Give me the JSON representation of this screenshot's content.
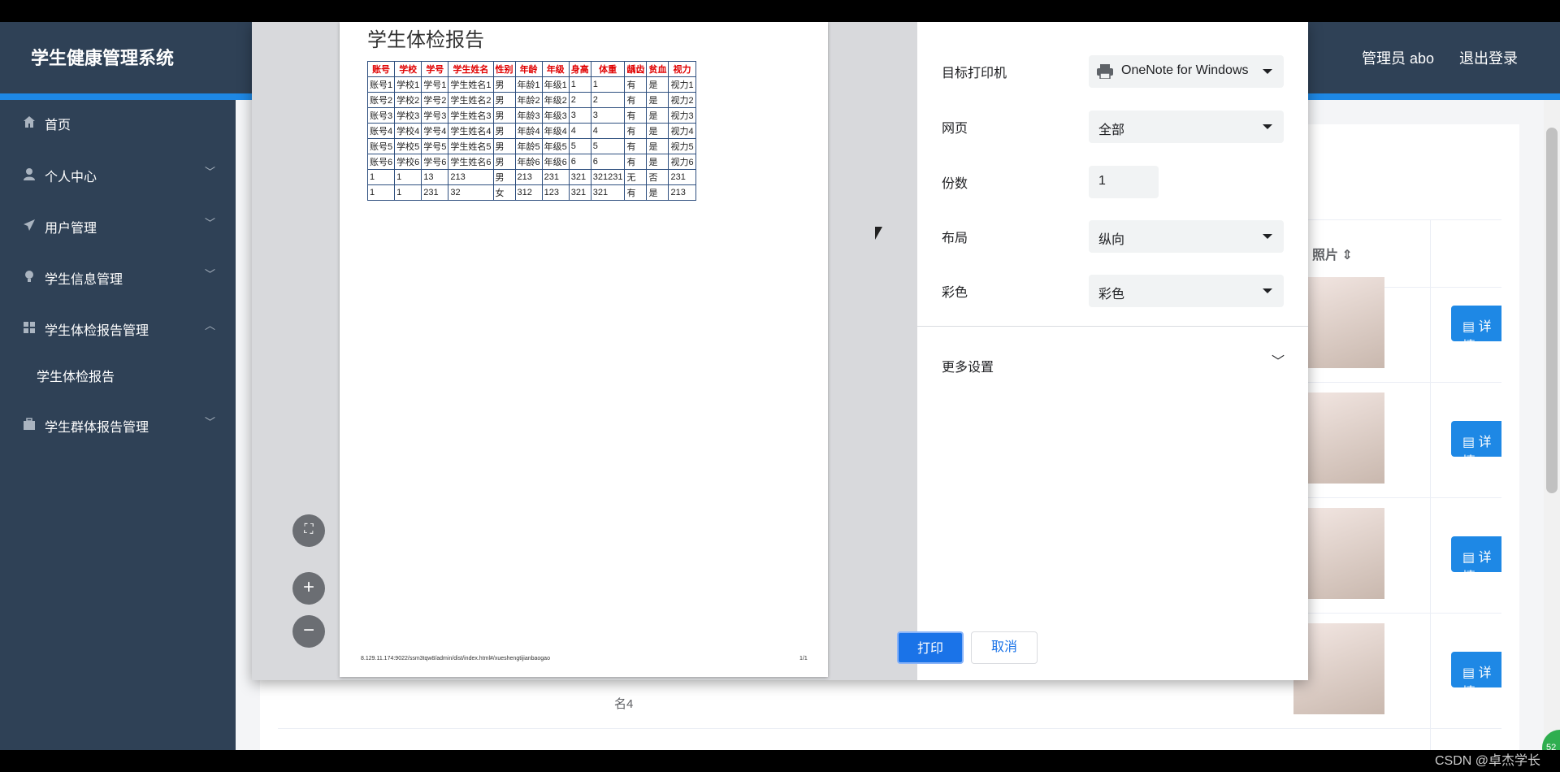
{
  "app": {
    "title": "学生健康管理系统",
    "user": "管理员 abo",
    "logout": "退出登录"
  },
  "sidebar": {
    "items": [
      {
        "label": "首页",
        "icon": "home-icon"
      },
      {
        "label": "个人中心",
        "icon": "user-icon"
      },
      {
        "label": "用户管理",
        "icon": "send-icon"
      },
      {
        "label": "学生信息管理",
        "icon": "bulb-icon"
      },
      {
        "label": "学生体检报告管理",
        "icon": "grid-icon"
      },
      {
        "label": "学生群体报告管理",
        "icon": "briefcase-icon"
      }
    ],
    "sub_item": "学生体检报告"
  },
  "background": {
    "photo_header": "照片",
    "detail_label": "详情",
    "partial_cell": "名4"
  },
  "print_dialog": {
    "preview": {
      "title": "学生体检报告",
      "columns": [
        "账号",
        "学校",
        "学号",
        "学生姓名",
        "性别",
        "年龄",
        "年级",
        "身高",
        "体重",
        "龋齿",
        "贫血",
        "视力"
      ],
      "rows": [
        [
          "账号1",
          "学校1",
          "学号1",
          "学生姓名1",
          "男",
          "年龄1",
          "年级1",
          "1",
          "1",
          "有",
          "是",
          "视力1"
        ],
        [
          "账号2",
          "学校2",
          "学号2",
          "学生姓名2",
          "男",
          "年龄2",
          "年级2",
          "2",
          "2",
          "有",
          "是",
          "视力2"
        ],
        [
          "账号3",
          "学校3",
          "学号3",
          "学生姓名3",
          "男",
          "年龄3",
          "年级3",
          "3",
          "3",
          "有",
          "是",
          "视力3"
        ],
        [
          "账号4",
          "学校4",
          "学号4",
          "学生姓名4",
          "男",
          "年龄4",
          "年级4",
          "4",
          "4",
          "有",
          "是",
          "视力4"
        ],
        [
          "账号5",
          "学校5",
          "学号5",
          "学生姓名5",
          "男",
          "年龄5",
          "年级5",
          "5",
          "5",
          "有",
          "是",
          "视力5"
        ],
        [
          "账号6",
          "学校6",
          "学号6",
          "学生姓名6",
          "男",
          "年龄6",
          "年级6",
          "6",
          "6",
          "有",
          "是",
          "视力6"
        ],
        [
          "1",
          "1",
          "13",
          "213",
          "男",
          "213",
          "231",
          "321",
          "321231",
          "无",
          "否",
          "231"
        ],
        [
          "1",
          "1",
          "231",
          "32",
          "女",
          "312",
          "123",
          "321",
          "321",
          "有",
          "是",
          "213"
        ]
      ],
      "url": "8.129.11.174:9022/ssm3tqw8/admin/dist/index.html#/xueshengtijianbaogao",
      "page": "1/1"
    },
    "settings": {
      "destination_label": "目标打印机",
      "destination_value": "OneNote for Windows",
      "pages_label": "网页",
      "pages_value": "全部",
      "copies_label": "份数",
      "copies_value": "1",
      "layout_label": "布局",
      "layout_value": "纵向",
      "color_label": "彩色",
      "color_value": "彩色",
      "more_label": "更多设置"
    },
    "print_button": "打印",
    "cancel_button": "取消"
  },
  "watermark": "CSDN @卓杰学长",
  "badge": "52",
  "colors": {
    "sidebar": "#2f4156",
    "accent": "#1e88e5",
    "print_button": "#1a73e8",
    "table_header_text": "#e00000"
  }
}
